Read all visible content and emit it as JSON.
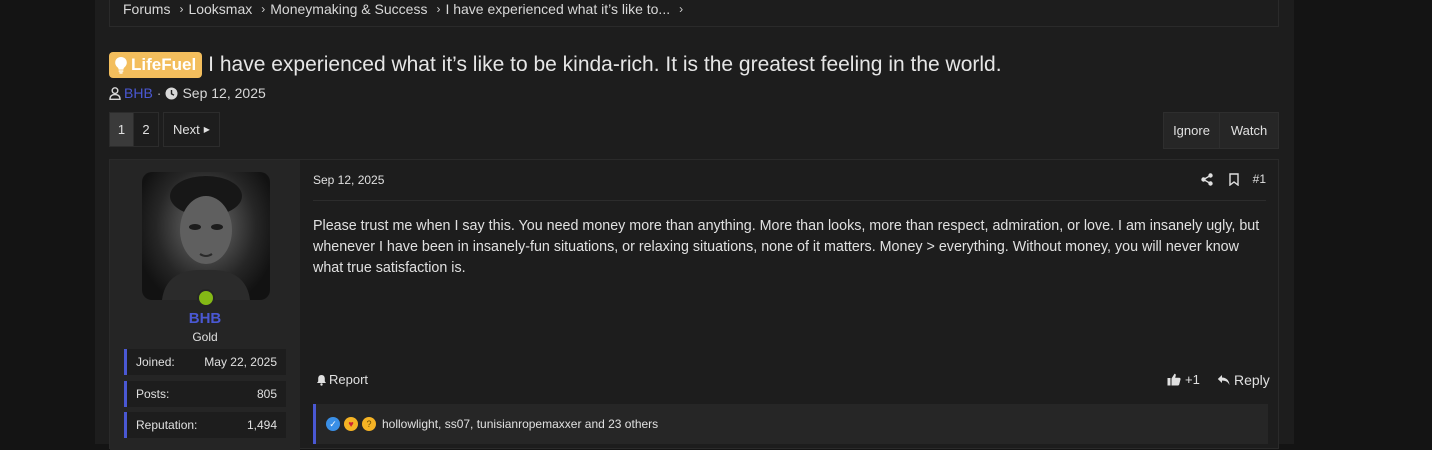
{
  "breadcrumbs": [
    "Forums",
    "Looksmax",
    "Moneymaking & Success",
    "I have experienced what it’s like to..."
  ],
  "thread": {
    "prefix": "LifeFuel",
    "title": "I have experienced what it’s like to be kinda-rich. It is the greatest feeling in the world.",
    "author": "BHB",
    "date": "Sep 12, 2025"
  },
  "pagination": {
    "pages": [
      "1",
      "2"
    ],
    "current": "1",
    "next_label": "Next"
  },
  "thread_actions": {
    "ignore_label": "Ignore",
    "watch_label": "Watch"
  },
  "post": {
    "user": {
      "name": "BHB",
      "rank": "Gold",
      "online": true,
      "stats": [
        {
          "label": "Joined:",
          "value": "May 22, 2025"
        },
        {
          "label": "Posts:",
          "value": "805"
        },
        {
          "label": "Reputation:",
          "value": "1,494"
        }
      ]
    },
    "date": "Sep 12, 2025",
    "number": "#1",
    "body": "Please trust me when I say this. You need money more than anything. More than looks, more than respect, admiration, or love. I am insanely ugly, but whenever I have been in insanely-fun situations, or relaxing situations, none of it matters. Money > everything. Without money, you will never know what true satisfaction is.",
    "report_label": "Report",
    "like_count": "+1",
    "reply_label": "Reply",
    "reactions_text": "hollowlight, ss07, tunisianropemaxxer and 23 others"
  },
  "colors": {
    "accent": "#4a58d3",
    "prefix_bg": "#f3be5d",
    "online": "#84b916"
  }
}
